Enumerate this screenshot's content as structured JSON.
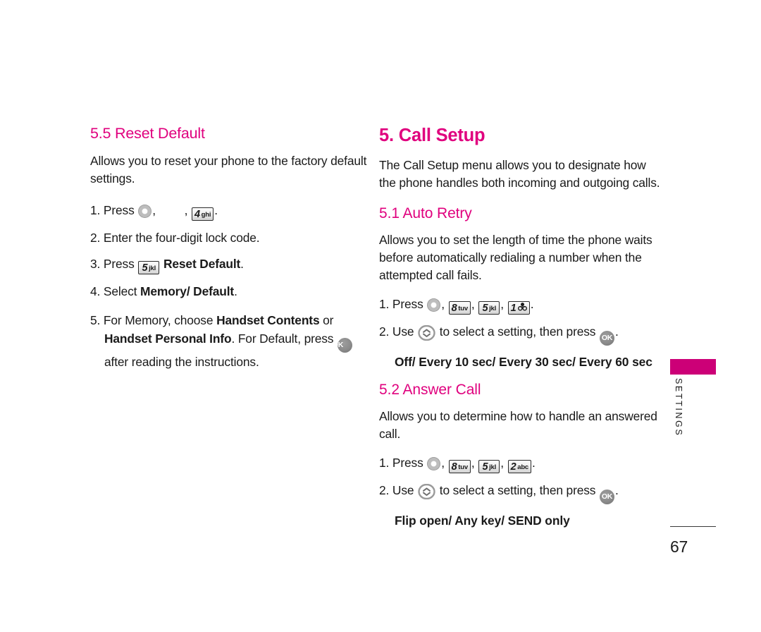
{
  "document": {
    "page_number": "67",
    "side_tab_label": "SETTINGS",
    "accent_color": "#E0007E",
    "tab_color": "#CC0077"
  },
  "left_column": {
    "heading": "5.5 Reset Default",
    "intro": "Allows you to reset your phone to the factory default settings.",
    "steps": [
      {
        "number": "1.",
        "verb": "Press",
        "keys": [
          {
            "icon": "menu-round-key"
          },
          {
            "icon": "blank-key"
          },
          {
            "icon": "keycap",
            "digit": "4",
            "letters": "ghi"
          }
        ],
        "trailing": "."
      },
      {
        "number": "2.",
        "text": "Enter the four-digit lock code."
      },
      {
        "number": "3.",
        "verb": "Press",
        "keys": [
          {
            "icon": "keycap",
            "digit": "5",
            "letters": "jkl"
          }
        ],
        "bold_after": "Reset Default",
        "trailing": "."
      },
      {
        "number": "4.",
        "verb": "Select",
        "bold_after": "Memory/ Default",
        "trailing": "."
      },
      {
        "number": "5.",
        "rich": [
          {
            "t": "text",
            "v": "For Memory, choose "
          },
          {
            "t": "bold",
            "v": "Handset Contents"
          },
          {
            "t": "text",
            "v": " or "
          },
          {
            "t": "bold",
            "v": "Handset Personal Info"
          },
          {
            "t": "text",
            "v": ". For Default, press "
          },
          {
            "t": "ok-key",
            "v": "OK"
          },
          {
            "t": "text",
            "v": " after reading the instructions."
          }
        ]
      }
    ]
  },
  "right_column": {
    "heading": "5. Call Setup",
    "intro": "The Call Setup menu allows you to designate how the phone handles both incoming and outgoing calls.",
    "sections": [
      {
        "heading": "5.1 Auto Retry",
        "intro": "Allows you to set the length of time the phone waits before automatically redialing a number when the attempted call fails.",
        "step1_number": "1.",
        "step1_verb": "Press",
        "step1_keys": [
          {
            "icon": "menu-round-key"
          },
          {
            "icon": "keycap",
            "digit": "8",
            "letters": "tuv"
          },
          {
            "icon": "keycap",
            "digit": "5",
            "letters": "jkl"
          },
          {
            "icon": "keycap",
            "digit": "1",
            "letters": "voicemail-glyph"
          }
        ],
        "step2_number": "2.",
        "step2_pre": "Use",
        "step2_mid": "to select a setting, then press",
        "step2_post": ".",
        "options": "Off/ Every 10 sec/ Every 30 sec/ Every 60 sec"
      },
      {
        "heading": "5.2 Answer Call",
        "intro": "Allows you to determine how to handle an answered call.",
        "step1_number": "1.",
        "step1_verb": "Press",
        "step1_keys": [
          {
            "icon": "menu-round-key"
          },
          {
            "icon": "keycap",
            "digit": "8",
            "letters": "tuv"
          },
          {
            "icon": "keycap",
            "digit": "5",
            "letters": "jkl"
          },
          {
            "icon": "keycap",
            "digit": "2",
            "letters": "abc"
          }
        ],
        "step2_number": "2.",
        "step2_pre": "Use",
        "step2_mid": "to select a setting, then press",
        "step2_post": ".",
        "options": "Flip open/ Any key/ SEND only"
      }
    ]
  },
  "icon_labels": {
    "ok": "OK",
    "comma": ",",
    "period": "."
  }
}
